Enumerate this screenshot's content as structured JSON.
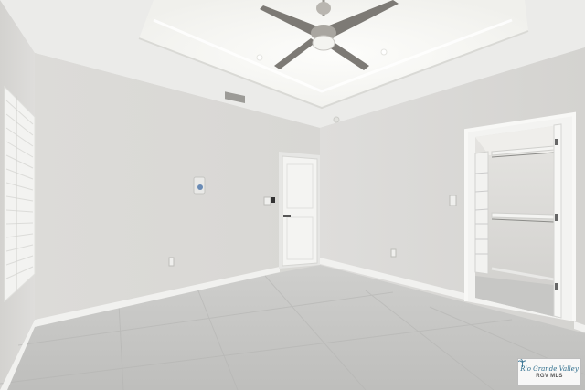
{
  "scene": {
    "description_free": true,
    "colors": {
      "wall": "#dcdbd8",
      "wall_shadow": "#cfceca",
      "ceiling": "#eeeeec",
      "tray_glow": "#fbfbf8",
      "floor": "#c9c9c7",
      "baseboard": "#f4f4f2",
      "door": "#f2f2f0",
      "fan_blade": "#7d7a75",
      "fan_metal": "#b9b6b0"
    },
    "icons": [
      "ceiling-fan-icon",
      "window-shutter-icon",
      "light-switch-icon",
      "door-handle-icon",
      "closet-shelf-icon"
    ]
  },
  "watermark": {
    "logo_text": "Rio Grande Valley",
    "sub_text": "RGV MLS",
    "color": "#2f6e8e"
  }
}
